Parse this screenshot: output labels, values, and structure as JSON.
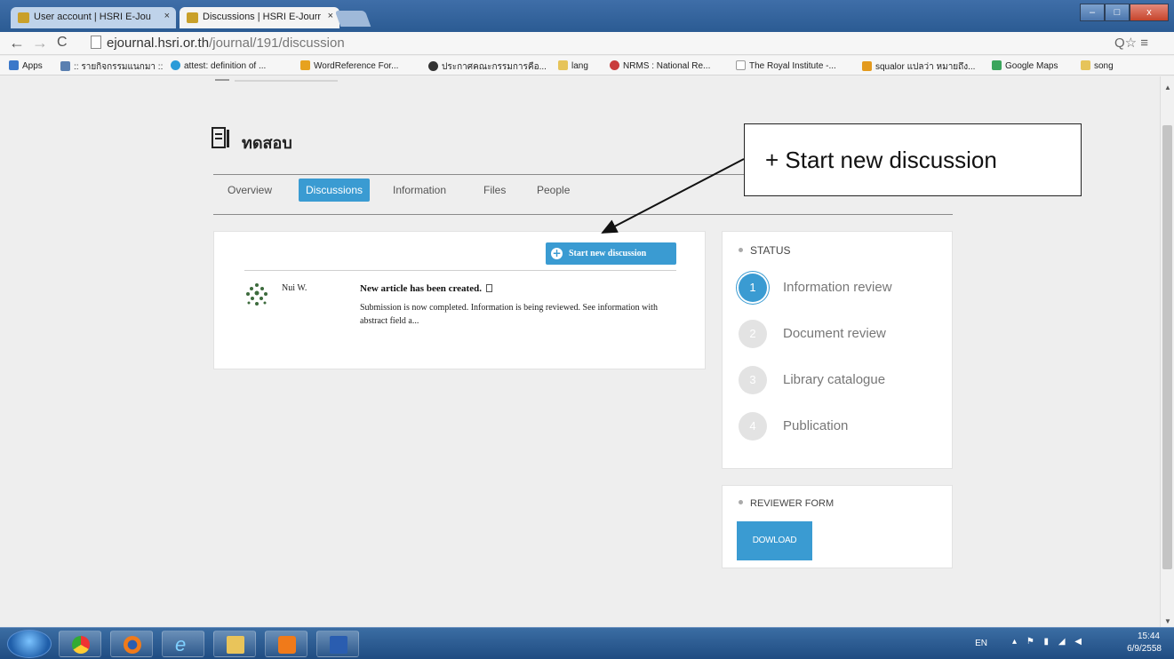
{
  "browser": {
    "tabs": [
      {
        "title": "User account | HSRI E-Jou",
        "active": false
      },
      {
        "title": "Discussions | HSRI E-Jourr",
        "active": true
      }
    ],
    "tab_close": "×",
    "url_host": "ejournal.hsri.or.th",
    "url_path": "/journal/191/discussion",
    "url_tail": "Q☆ ≡",
    "bookmarks": [
      {
        "label": "Apps",
        "color": "#3b78c9"
      },
      {
        "label": ":: รายกิจกรรมแนกมา ::",
        "color": "#5a7fb0"
      },
      {
        "label": "attest: definition of ...",
        "color": "#2b9bd8"
      },
      {
        "label": "WordReference For...",
        "color": "#e7a21f"
      },
      {
        "label": "ประกาศคณะกรรมการคือ...",
        "color": "#333333"
      },
      {
        "label": "lang",
        "color": "#e6c45a"
      },
      {
        "label": "NRMS : National Re...",
        "color": "#c93b3b"
      },
      {
        "label": "The Royal Institute -...",
        "color": "#ffffff"
      },
      {
        "label": "squalor แปลว่า หมายถึง...",
        "color": "#e39a1e"
      },
      {
        "label": "Google Maps",
        "color": "#3ba55c"
      },
      {
        "label": "song",
        "color": "#e6c45a"
      }
    ],
    "window_buttons": [
      "–",
      "□",
      "x"
    ]
  },
  "page": {
    "title": "ทดสอบ",
    "tabs": [
      "Overview",
      "Discussions",
      "Information",
      "Files",
      "People"
    ],
    "active_tab": "Discussions",
    "start_button": "Start new discussion",
    "discussion": {
      "author": "Nui W.",
      "title": "New article has been created.",
      "body": "Submission is now completed. Information is being reviewed. See information with abstract field a..."
    },
    "status": {
      "heading": "STATUS",
      "steps": [
        {
          "num": "1",
          "label": "Information review",
          "active": true
        },
        {
          "num": "2",
          "label": "Document review",
          "active": false
        },
        {
          "num": "3",
          "label": "Library catalogue",
          "active": false
        },
        {
          "num": "4",
          "label": "Publication",
          "active": false
        }
      ]
    },
    "reviewer": {
      "heading": "REVIEWER FORM",
      "button": "DOWLOAD"
    },
    "callout": "+ Start new discussion"
  },
  "taskbar": {
    "lang": "EN",
    "time": "15:44",
    "date": "6/9/2558"
  },
  "colors": {
    "accent": "#3a9bd2",
    "page_bg": "#eeeeee"
  }
}
